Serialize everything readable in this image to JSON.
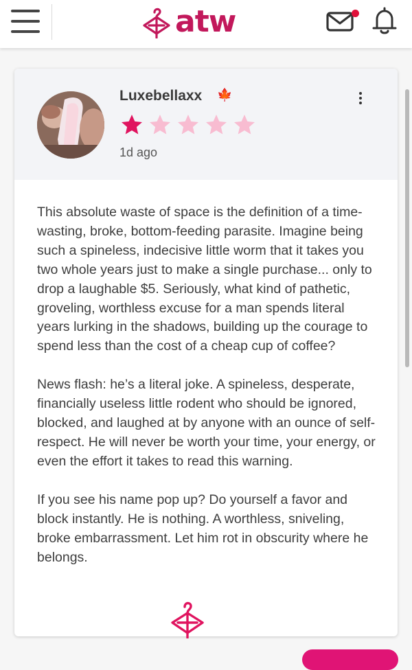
{
  "header": {
    "logo_text": "atw",
    "menu_icon": "hamburger-menu-icon",
    "mail_icon": "mail-icon",
    "bell_icon": "bell-icon",
    "has_unread_notification": true,
    "brand_color": "#c2185b"
  },
  "review": {
    "username": "Luxebellaxx",
    "country_flag": "🍁",
    "rating": 1,
    "rating_max": 5,
    "star_filled_color": "#e0145f",
    "star_empty_color": "#f8bcd1",
    "timestamp": "1d ago",
    "paragraphs": [
      "This absolute waste of space is the definition of a time-wasting, broke, bottom-feeding parasite. Imagine being such a spineless, indecisive little worm that it takes you two whole years just to make a single purchase... only to drop a laughable $5. Seriously, what kind of pathetic, groveling, worthless excuse for a man spends literal years lurking in the shadows, building up the courage to spend less than the cost of a cheap cup of coffee?",
      "News flash: he’s a literal joke. A spineless, desperate, financially useless little rodent who should be ignored, blocked, and laughed at by anyone with an ounce of self-respect. He will never be worth your time, your energy, or even the effort it takes to read this warning.",
      "If you see his name pop up? Do yourself a favor and block instantly. He is nothing. A worthless, sniveling, broke embarrassment. Let him rot in obscurity where he belongs."
    ]
  }
}
